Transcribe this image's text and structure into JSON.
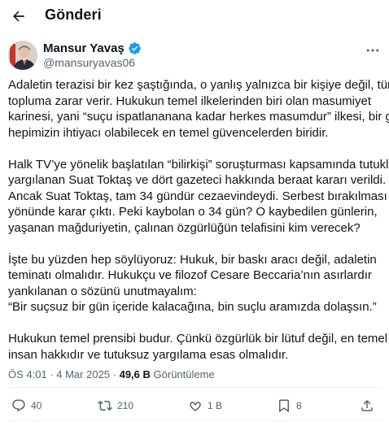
{
  "header": {
    "title": "Gönderi"
  },
  "author": {
    "name": "Mansur Yavaş",
    "handle": "@mansuryavas06"
  },
  "post": {
    "paragraphs": [
      [
        "Adaletin terazisi bir kez şaştığında, o yanlış yalnızca bir kişiye değil, tüm",
        "topluma zarar verir. Hukukun temel ilkelerinden biri olan masumiyet",
        "karinesi, yani “suçu ispatlananana kadar herkes masumdur” ilkesi, bir gün",
        "hepimizin ihtiyacı olabilecek en temel güvencelerden biridir."
      ],
      [
        "Halk TV’ye yönelik başlatılan “bilirkişi” soruşturması kapsamında tutuklu",
        "yargılanan Suat Toktaş ve dört gazeteci hakkında beraat kararı verildi.",
        "Ancak Suat Toktaş, tam 34 gündür cezaevindeydi.  Serbest bırakılması",
        "yönünde karar çıktı. Peki kaybolan o 34 gün? O kaybedilen günlerin,",
        "yaşanan mağduriyetin, çalınan özgürlüğün telafisini kim verecek?"
      ],
      [
        "İşte bu yüzden hep söylüyoruz: Hukuk, bir baskı aracı değil, adaletin",
        "teminatı olmalıdır. Hukukçu ve filozof Cesare Beccaria’nın asırlardır",
        "yankılanan o sözünü unutmayalım:",
        "“Bir suçsuz bir gün içeride kalacağına, bin suçlu aramızda dolaşsın.”"
      ],
      [
        "Hukukun temel prensibi budur. Çünkü özgürlük bir lütuf değil, en temel",
        "insan hakkıdır ve tutuksuz yargılama esas olmalıdır."
      ]
    ]
  },
  "meta": {
    "time": "ÖS 4:01",
    "separator": " · ",
    "date": "4 Mar 2025",
    "views_count": "49,6 B",
    "views_label": "Görüntüleme"
  },
  "actions": {
    "replies": "40",
    "reposts": "210",
    "likes": "1 B",
    "bookmarks": "8"
  },
  "colors": {
    "text": "#0f1419",
    "secondary": "#536471",
    "verified": "#1d9bf0",
    "divider": "#eff3f4"
  },
  "icons": [
    "back-arrow-icon",
    "verified-badge-icon",
    "more-options-icon",
    "reply-icon",
    "repost-icon",
    "like-icon",
    "views-icon",
    "share-icon"
  ]
}
